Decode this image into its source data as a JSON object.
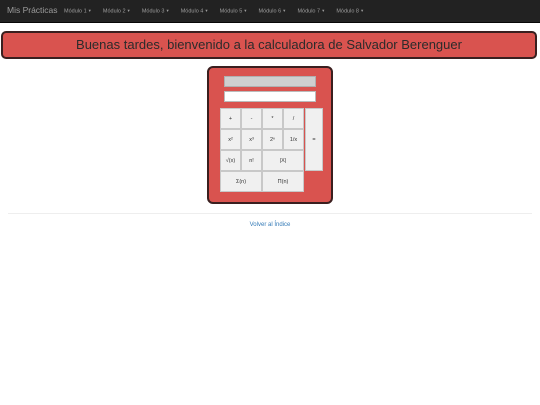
{
  "navbar": {
    "brand": "Mis Prácticas",
    "menus": [
      {
        "label": "Módulo 1"
      },
      {
        "label": "Módulo 2"
      },
      {
        "label": "Módulo 3"
      },
      {
        "label": "Módulo 4"
      },
      {
        "label": "Módulo 5"
      },
      {
        "label": "Módulo 6"
      },
      {
        "label": "Módulo 7"
      },
      {
        "label": "Módulo 8"
      }
    ],
    "caret": "▾"
  },
  "banner": {
    "text": "Buenas tardes, bienvenido a la calculadora de Salvador Berenguer"
  },
  "calculator": {
    "display": "",
    "input_value": "",
    "keys": {
      "add": "+",
      "subtract": "-",
      "multiply": "*",
      "divide": "/",
      "square": "x²",
      "cube": "x³",
      "power_of_two": "2ⁿ",
      "reciprocal": "1/x",
      "equals": "=",
      "sqrt": "√(x)",
      "factorial": "n!",
      "abs": "|X|",
      "summation": "Σ(n)",
      "product": "Π(n)"
    }
  },
  "footer": {
    "back_link": "Volver al Índice"
  },
  "colors": {
    "navbar": "#222222",
    "accent": "#d9534f",
    "border": "#3a1f1f",
    "link": "#337ab7"
  }
}
